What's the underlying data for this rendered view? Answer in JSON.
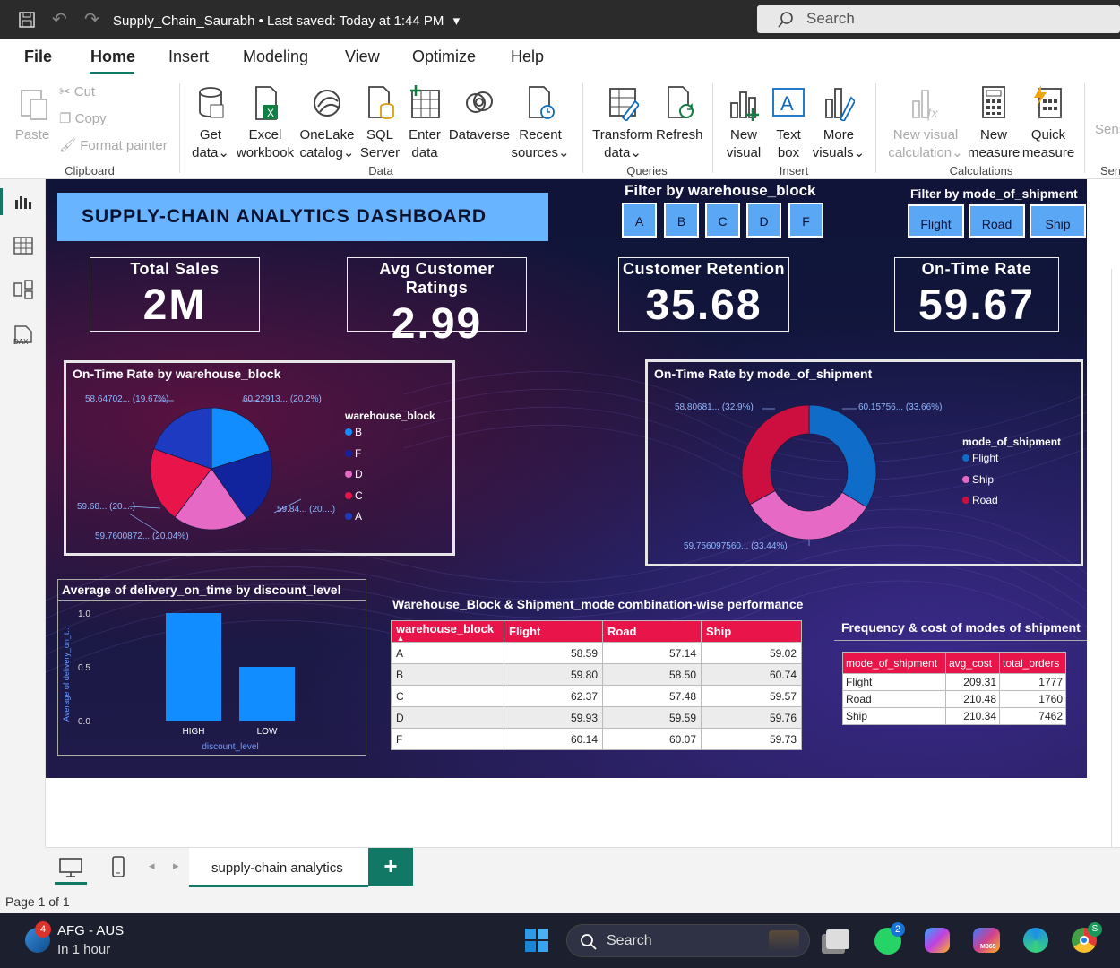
{
  "titlebar": {
    "doc_name": "Supply_Chain_Saurabh",
    "saved": "Last saved: Today at 1:44 PM",
    "search_placeholder": "Search"
  },
  "menu": [
    "File",
    "Home",
    "Insert",
    "Modeling",
    "View",
    "Optimize",
    "Help"
  ],
  "ribbon": {
    "clipboard": {
      "paste": "Paste",
      "cut": "Cut",
      "copy": "Copy",
      "format_painter": "Format painter",
      "label": "Clipboard"
    },
    "data": {
      "get_data": [
        "Get",
        "data"
      ],
      "excel": [
        "Excel",
        "workbook"
      ],
      "onelake": [
        "OneLake",
        "catalog"
      ],
      "sql": [
        "SQL",
        "Server"
      ],
      "enter": [
        "Enter",
        "data"
      ],
      "dataverse": "Dataverse",
      "recent": [
        "Recent",
        "sources"
      ],
      "label": "Data"
    },
    "queries": {
      "transform": [
        "Transform",
        "data"
      ],
      "refresh": "Refresh",
      "label": "Queries"
    },
    "insert": {
      "new_visual": [
        "New",
        "visual"
      ],
      "text_box": [
        "Text",
        "box"
      ],
      "more_visuals": [
        "More",
        "visuals"
      ],
      "label": "Insert"
    },
    "calculations": {
      "new_visual_calc": [
        "New visual",
        "calculation"
      ],
      "new_measure": [
        "New",
        "measure"
      ],
      "quick_measure": [
        "Quick",
        "measure"
      ],
      "label": "Calculations"
    },
    "sens": [
      "Sens",
      "Sen"
    ]
  },
  "dashboard": {
    "title": "SUPPLY-CHAIN ANALYTICS DASHBOARD",
    "filter_warehouse": {
      "title": "Filter by warehouse_block",
      "options": [
        "A",
        "B",
        "C",
        "D",
        "F"
      ]
    },
    "filter_mode": {
      "title": "Filter by mode_of_shipment",
      "options": [
        "Flight",
        "Road",
        "Ship"
      ]
    },
    "kpis": [
      {
        "label": "Total Sales",
        "value": "2M"
      },
      {
        "label": "Avg Customer Ratings",
        "value": "2.99"
      },
      {
        "label": "Customer Retention",
        "value": "35.68"
      },
      {
        "label": "On-Time Rate",
        "value": "59.67"
      }
    ],
    "pie": {
      "title": "On-Time Rate by warehouse_block",
      "legend_title": "warehouse_block",
      "labels": [
        "60.22913... (20.2%)",
        "59.84... (20....)",
        "59.7600872... (20.04%)",
        "59.68... (20....)",
        "58.64702... (19.67%)"
      ]
    },
    "donut": {
      "title": "On-Time Rate by mode_of_shipment",
      "legend_title": "mode_of_shipment",
      "labels": [
        "60.15756... (33.66%)",
        "59.756097560... (33.44%)",
        "58.80681... (32.9%)"
      ]
    },
    "bar": {
      "title": "Average of delivery_on_time by discount_level"
    },
    "table1": {
      "title": "Warehouse_Block & Shipment_mode combination-wise performance",
      "headers": [
        "warehouse_block",
        "Flight",
        "Road",
        "Ship"
      ],
      "rows": [
        [
          "A",
          "58.59",
          "57.14",
          "59.02"
        ],
        [
          "B",
          "59.80",
          "58.50",
          "60.74"
        ],
        [
          "C",
          "62.37",
          "57.48",
          "59.57"
        ],
        [
          "D",
          "59.93",
          "59.59",
          "59.76"
        ],
        [
          "F",
          "60.14",
          "60.07",
          "59.73"
        ]
      ]
    },
    "table2": {
      "title": "Frequency & cost of modes of shipment",
      "headers": [
        "mode_of_shipment",
        "avg_cost",
        "total_orders"
      ],
      "rows": [
        [
          "Flight",
          "209.31",
          "1777"
        ],
        [
          "Road",
          "210.48",
          "1760"
        ],
        [
          "Ship",
          "210.34",
          "7462"
        ]
      ]
    }
  },
  "chart_data": [
    {
      "type": "pie",
      "title": "On-Time Rate by warehouse_block",
      "legend_title": "warehouse_block",
      "categories": [
        "B",
        "F",
        "D",
        "C",
        "A"
      ],
      "values": [
        60.22913,
        59.84,
        59.7600872,
        59.68,
        58.64702
      ],
      "percents": [
        20.2,
        20.07,
        20.04,
        20.02,
        19.67
      ],
      "colors": [
        "#118dff",
        "#12239e",
        "#e66ac5",
        "#e8144a",
        "#1e3ac0"
      ],
      "legend_placement": "right"
    },
    {
      "type": "pie",
      "subtype": "donut",
      "title": "On-Time Rate by mode_of_shipment",
      "legend_title": "mode_of_shipment",
      "categories": [
        "Flight",
        "Ship",
        "Road"
      ],
      "values": [
        60.15756,
        59.75609756,
        58.80681
      ],
      "percents": [
        33.66,
        33.44,
        32.9
      ],
      "colors": [
        "#0f6cc8",
        "#e66ac5",
        "#cc0f3e"
      ],
      "legend_placement": "right"
    },
    {
      "type": "bar",
      "title": "Average of delivery_on_time by discount_level",
      "xlabel": "discount_level",
      "ylabel": "Average of delivery_on_t...",
      "categories": [
        "HIGH",
        "LOW"
      ],
      "values": [
        1.0,
        0.5
      ],
      "ylim": [
        0,
        1.0
      ],
      "yticks": [
        "0.0",
        "0.5",
        "1.0"
      ],
      "color": "#118dff",
      "grid": false
    }
  ],
  "tabs": {
    "page": "supply-chain analytics",
    "add": "+"
  },
  "status": {
    "page": "Page 1 of 1"
  },
  "taskbar": {
    "weather_title": "AFG - AUS",
    "weather_sub": "In 1 hour",
    "weather_badge": "4",
    "search": "Search",
    "whatsapp_badge": "2",
    "m365": "M365"
  }
}
